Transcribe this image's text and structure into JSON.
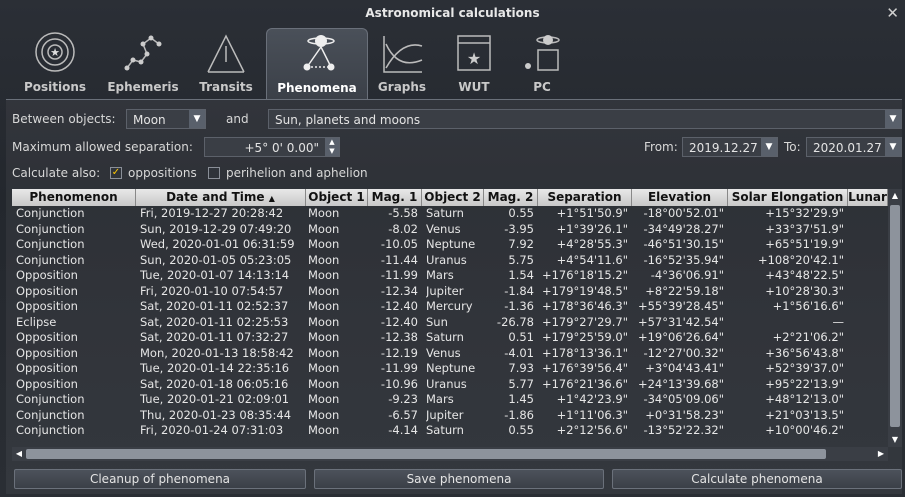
{
  "window": {
    "title": "Astronomical calculations",
    "close": "✕"
  },
  "tabs": [
    {
      "label": "Positions",
      "icon": "orbit-icon"
    },
    {
      "label": "Ephemeris",
      "icon": "ephemeris-icon"
    },
    {
      "label": "Transits",
      "icon": "transit-icon"
    },
    {
      "label": "Phenomena",
      "icon": "phenomena-icon",
      "active": true
    },
    {
      "label": "Graphs",
      "icon": "graph-icon"
    },
    {
      "label": "WUT",
      "icon": "calendar-star-icon"
    },
    {
      "label": "PC",
      "icon": "planet-calendar-icon"
    }
  ],
  "controls": {
    "between_label": "Between objects:",
    "object1": "Moon",
    "and_label": "and",
    "object2": "Sun, planets and moons",
    "max_sep_label": "Maximum allowed separation:",
    "max_sep_value": "+5° 0' 0.00\"",
    "from_label": "From:",
    "from_value": "2019.12.27",
    "to_label": "To:",
    "to_value": "2020.01.27",
    "calc_also_label": "Calculate also:",
    "opp_label": "oppositions",
    "opp_checked": true,
    "peri_label": "perihelion and aphelion",
    "peri_checked": false
  },
  "table": {
    "headers": [
      "Phenomenon",
      "Date and Time",
      "Object 1",
      "Mag. 1",
      "Object 2",
      "Mag. 2",
      "Separation",
      "Elevation",
      "Solar Elongation",
      "Lunar"
    ],
    "sort_indicator": "▲",
    "rows": [
      [
        "Conjunction",
        "Fri, 2019-12-27 20:28:42",
        "Moon",
        "-5.58",
        "Saturn",
        "0.55",
        "+1°51'50.9\"",
        "-18°00'52.01\"",
        "+15°32'29.9\""
      ],
      [
        "Conjunction",
        "Sun, 2019-12-29 07:49:20",
        "Moon",
        "-8.02",
        "Venus",
        "-3.95",
        "+1°39'26.1\"",
        "-34°49'28.27\"",
        "+33°37'51.9\""
      ],
      [
        "Conjunction",
        "Wed, 2020-01-01 06:31:59",
        "Moon",
        "-10.05",
        "Neptune",
        "7.92",
        "+4°28'55.3\"",
        "-46°51'30.15\"",
        "+65°51'19.9\""
      ],
      [
        "Conjunction",
        "Sun, 2020-01-05 05:23:05",
        "Moon",
        "-11.44",
        "Uranus",
        "5.75",
        "+4°54'11.6\"",
        "-16°52'35.94\"",
        "+108°20'42.1\""
      ],
      [
        "Opposition",
        "Tue, 2020-01-07 14:13:14",
        "Moon",
        "-11.99",
        "Mars",
        "1.54",
        "+176°18'15.2\"",
        "-4°36'06.91\"",
        "+43°48'22.5\""
      ],
      [
        "Opposition",
        "Fri, 2020-01-10 07:54:57",
        "Moon",
        "-12.34",
        "Jupiter",
        "-1.84",
        "+179°19'48.5\"",
        "+8°22'59.18\"",
        "+10°28'30.3\""
      ],
      [
        "Opposition",
        "Sat, 2020-01-11 02:52:37",
        "Moon",
        "-12.40",
        "Mercury",
        "-1.36",
        "+178°36'46.3\"",
        "+55°39'28.45\"",
        "+1°56'16.6\""
      ],
      [
        "Eclipse",
        "Sat, 2020-01-11 02:25:53",
        "Moon",
        "-12.40",
        "Sun",
        "-26.78",
        "+179°27'29.7\"",
        "+57°31'42.54\"",
        "—"
      ],
      [
        "Opposition",
        "Sat, 2020-01-11 07:32:27",
        "Moon",
        "-12.38",
        "Saturn",
        "0.51",
        "+179°25'59.0\"",
        "+19°06'26.64\"",
        "+2°21'06.2\""
      ],
      [
        "Opposition",
        "Mon, 2020-01-13 18:58:42",
        "Moon",
        "-12.19",
        "Venus",
        "-4.01",
        "+178°13'36.1\"",
        "-12°27'00.32\"",
        "+36°56'43.8\""
      ],
      [
        "Opposition",
        "Tue, 2020-01-14 22:35:16",
        "Moon",
        "-11.99",
        "Neptune",
        "7.93",
        "+176°39'56.4\"",
        "+3°04'43.41\"",
        "+52°39'37.0\""
      ],
      [
        "Opposition",
        "Sat, 2020-01-18 06:05:16",
        "Moon",
        "-10.96",
        "Uranus",
        "5.77",
        "+176°21'36.6\"",
        "+24°13'39.68\"",
        "+95°22'13.9\""
      ],
      [
        "Conjunction",
        "Tue, 2020-01-21 02:09:01",
        "Moon",
        "-9.23",
        "Mars",
        "1.45",
        "+1°42'23.9\"",
        "-34°05'09.06\"",
        "+48°12'13.0\""
      ],
      [
        "Conjunction",
        "Thu, 2020-01-23 08:35:44",
        "Moon",
        "-6.57",
        "Jupiter",
        "-1.86",
        "+1°11'06.3\"",
        "+0°31'58.23\"",
        "+21°03'13.5\""
      ],
      [
        "Conjunction",
        "Fri, 2020-01-24 07:31:03",
        "Moon",
        "-4.14",
        "Saturn",
        "0.55",
        "+2°12'56.6\"",
        "-13°52'22.32\"",
        "+10°00'46.2\""
      ]
    ]
  },
  "buttons": {
    "cleanup": "Cleanup of phenomena",
    "save": "Save phenomena",
    "calculate": "Calculate phenomena"
  },
  "colors": {
    "accent_check": "#ffc800",
    "header_bg": "#d8d8d8"
  }
}
